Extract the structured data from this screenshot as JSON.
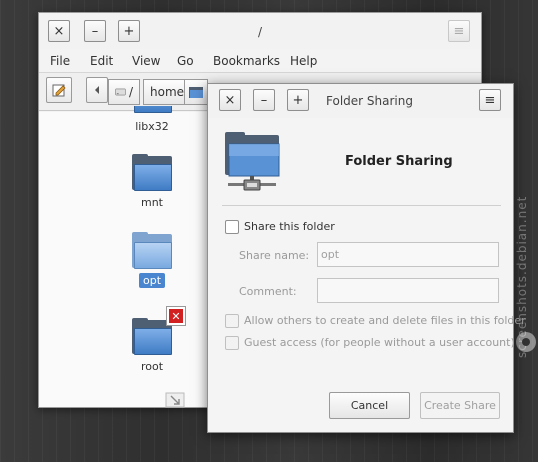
{
  "watermark": "screenshots.debian.net",
  "file_manager": {
    "title": "/",
    "menu": [
      "File",
      "Edit",
      "View",
      "Go",
      "Bookmarks",
      "Help"
    ],
    "breadcrumb": {
      "separator": "/",
      "home": "home"
    },
    "items": [
      {
        "name": "libx32",
        "state": "normal"
      },
      {
        "name": "mnt",
        "state": "normal"
      },
      {
        "name": "opt",
        "state": "selected"
      },
      {
        "name": "root",
        "state": "restricted"
      }
    ]
  },
  "dialog": {
    "title": "Folder Sharing",
    "heading": "Folder Sharing",
    "share_checkbox_label": "Share this folder",
    "share_name_label": "Share name:",
    "share_name_value": "opt",
    "comment_label": "Comment:",
    "comment_value": "",
    "allow_others_label": "Allow others to create and delete files in this folder",
    "guest_access_label": "Guest access (for people without a user account)",
    "cancel_label": "Cancel",
    "create_label": "Create Share"
  },
  "window_buttons": {
    "close": "×",
    "minimize": "–",
    "maximize": "+",
    "menu": "≡"
  },
  "colors": {
    "selection": "#4a86cf",
    "folder": "#3f7cc4",
    "emblem": "#d21f1f"
  }
}
